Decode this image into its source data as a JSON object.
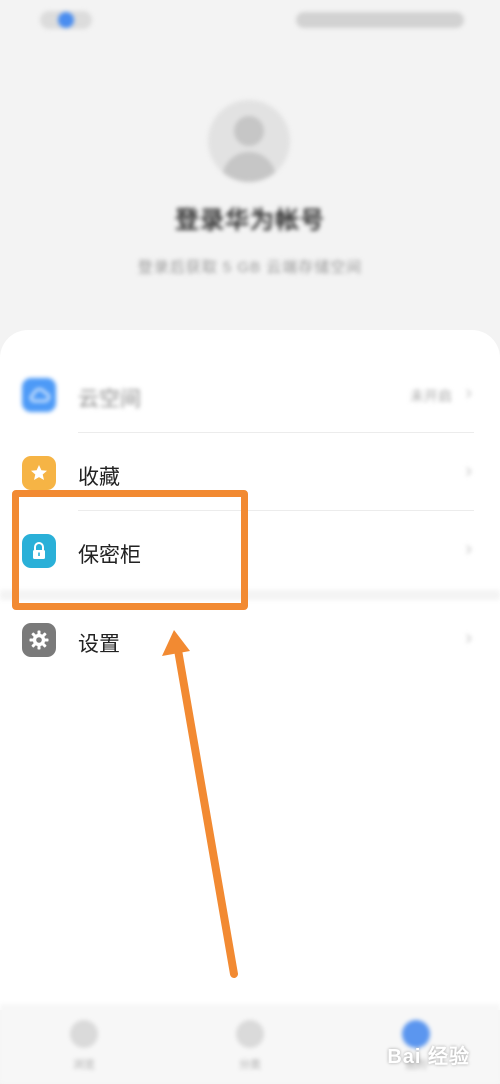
{
  "header": {
    "login_title": "登录华为帐号",
    "login_subtitle": "登录后获取 5 GB 云端存储空间"
  },
  "menu": {
    "cloud": {
      "label": "云空间",
      "value": "未开启",
      "icon": "cloud-icon",
      "color": "#4d9af7"
    },
    "favorites": {
      "label": "收藏",
      "icon": "star-icon",
      "color": "#f6b445"
    },
    "safe": {
      "label": "保密柜",
      "icon": "lock-icon",
      "color": "#2ab0d8"
    },
    "settings": {
      "label": "设置",
      "icon": "gear-icon",
      "color": "#7a7a7a"
    }
  },
  "bottom_nav": [
    {
      "label": "浏览",
      "icon": "browse-icon"
    },
    {
      "label": "分类",
      "icon": "category-icon"
    },
    {
      "label": "我的",
      "icon": "profile-icon",
      "active": true
    }
  ],
  "annotation": {
    "highlight_color": "#f28a32"
  },
  "watermark": "Bai 经验"
}
